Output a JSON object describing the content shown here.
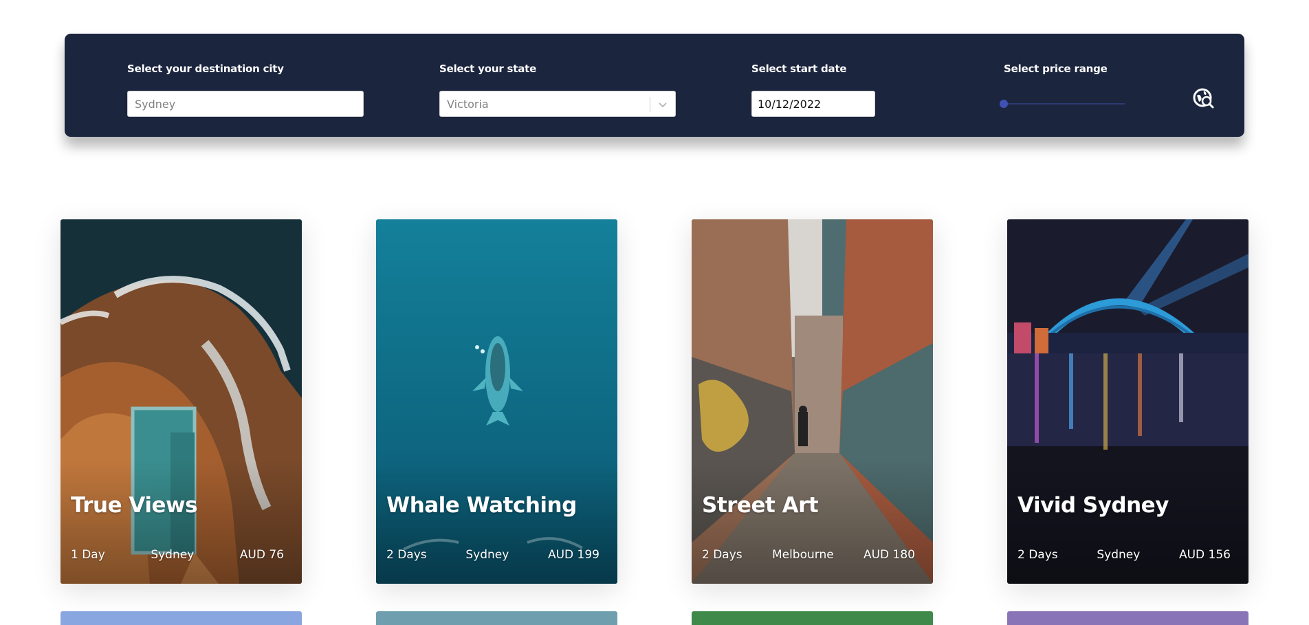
{
  "search": {
    "city_label": "Select your destination city",
    "city_value": "Sydney",
    "state_label": "Select your state",
    "state_value": "Victoria",
    "date_label": "Select start date",
    "date_value": "10/12/2022",
    "price_label": "Select price range",
    "price_slider_value": 0,
    "search_icon": "location-search-icon"
  },
  "cards": [
    {
      "title": "True Views",
      "duration": "1 Day",
      "city": "Sydney",
      "price": "AUD 76"
    },
    {
      "title": "Whale Watching",
      "duration": "2 Days",
      "city": "Sydney",
      "price": "AUD 199"
    },
    {
      "title": "Street Art",
      "duration": "2 Days",
      "city": "Melbourne",
      "price": "AUD 180"
    },
    {
      "title": "Vivid Sydney",
      "duration": "2 Days",
      "city": "Sydney",
      "price": "AUD 156"
    }
  ],
  "colors": {
    "search_bar_bg": "#1c253e",
    "slider_accent": "#3f51b5"
  }
}
